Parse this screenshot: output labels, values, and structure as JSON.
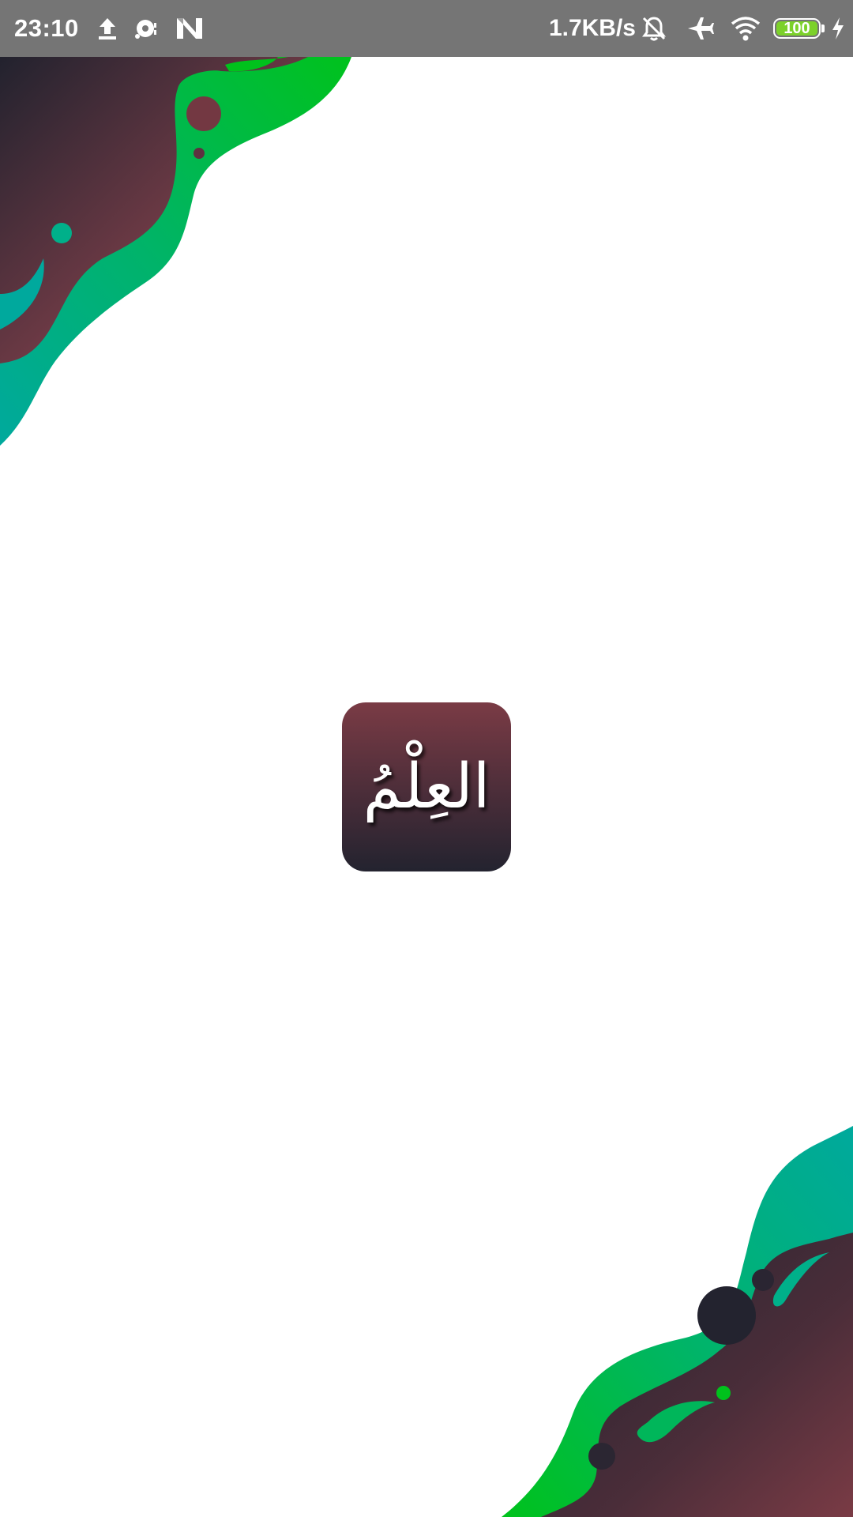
{
  "status_bar": {
    "time": "23:10",
    "network_speed": "1.7KB/s",
    "battery_level": "100",
    "left_icons": [
      "upload-icon",
      "vpn-key-icon",
      "n-notification-icon"
    ],
    "right_icons": [
      "bell-off-icon",
      "airplane-mode-icon",
      "wifi-icon",
      "battery-icon",
      "charging-icon"
    ],
    "background_color": "#757575",
    "battery_fill_color": "#7cd12a"
  },
  "splash": {
    "logo_text": "العِلْمُ",
    "logo_gradient": [
      "#7a3b45",
      "#23232f"
    ]
  },
  "decoration": {
    "colors": [
      "#00c21c",
      "#00a99d",
      "#7a3b45",
      "#23232f"
    ]
  }
}
